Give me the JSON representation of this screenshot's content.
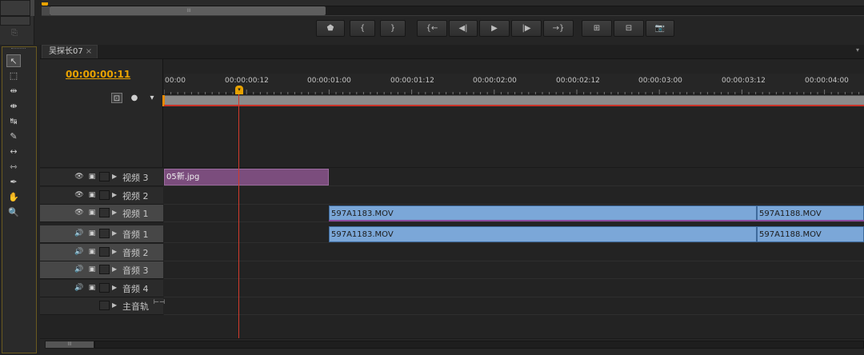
{
  "monitor": {
    "transport_buttons": [
      {
        "name": "add-marker-button",
        "glyph": "⬟"
      },
      {
        "name": "mark-in-button",
        "glyph": "{"
      },
      {
        "name": "mark-out-button",
        "glyph": "}"
      },
      {
        "name": "go-to-in-button",
        "glyph": "{←"
      },
      {
        "name": "step-back-button",
        "glyph": "◀|"
      },
      {
        "name": "play-stop-button",
        "glyph": "▶"
      },
      {
        "name": "step-forward-button",
        "glyph": "|▶"
      },
      {
        "name": "go-to-out-button",
        "glyph": "→}"
      },
      {
        "name": "lift-button",
        "glyph": "⊞"
      },
      {
        "name": "extract-button",
        "glyph": "⊟"
      },
      {
        "name": "export-frame-button",
        "glyph": "📷"
      }
    ]
  },
  "tools": [
    {
      "name": "selection-tool",
      "glyph": "↖",
      "selected": true
    },
    {
      "name": "track-select-tool",
      "glyph": "⬚"
    },
    {
      "name": "ripple-edit-tool",
      "glyph": "⇹"
    },
    {
      "name": "rolling-edit-tool",
      "glyph": "⇼"
    },
    {
      "name": "rate-stretch-tool",
      "glyph": "↹"
    },
    {
      "name": "razor-tool",
      "glyph": "✎"
    },
    {
      "name": "slip-tool",
      "glyph": "↔"
    },
    {
      "name": "slide-tool",
      "glyph": "⇿"
    },
    {
      "name": "pen-tool",
      "glyph": "✒"
    },
    {
      "name": "hand-tool",
      "glyph": "✋"
    },
    {
      "name": "zoom-tool",
      "glyph": "🔍"
    }
  ],
  "timeline": {
    "tab_label": "吴探长07",
    "tab_close": "×",
    "timecode": "00:00:00:11",
    "ruler_labels": [
      "00:00",
      "00:00:00:12",
      "00:00:01:00",
      "00:00:01:12",
      "00:00:02:00",
      "00:00:02:12",
      "00:00:03:00",
      "00:00:03:12",
      "00:00:04:00"
    ],
    "header_icons": {
      "snap": "⊡",
      "marker": "●",
      "set_marker": "▾"
    },
    "tracks": [
      {
        "kind": "video",
        "name": "视频 3",
        "visibility": "👁",
        "lock": "▣",
        "active": false
      },
      {
        "kind": "video",
        "name": "视频 2",
        "visibility": "👁",
        "lock": "▣",
        "active": false
      },
      {
        "kind": "video",
        "name": "视频 1",
        "visibility": "👁",
        "lock": "▣",
        "active": true
      },
      {
        "kind": "audio",
        "name": "音频 1",
        "visibility": "🔊",
        "lock": "▣",
        "active": true
      },
      {
        "kind": "audio",
        "name": "音频 2",
        "visibility": "🔊",
        "lock": "▣",
        "active": true
      },
      {
        "kind": "audio",
        "name": "音频 3",
        "visibility": "🔊",
        "lock": "▣",
        "active": true
      },
      {
        "kind": "audio",
        "name": "音频 4",
        "visibility": "🔊",
        "lock": "▣",
        "active": false
      },
      {
        "kind": "master",
        "name": "主音轨",
        "visibility": "",
        "lock": "",
        "active": false
      }
    ],
    "clips": {
      "v3_still": "05新.jpg",
      "v1_a": "597A1183.MOV",
      "v1_b": "597A1188.MOV",
      "a1_a": "597A1183.MOV",
      "a1_b": "597A1188.MOV"
    },
    "colors": {
      "timecode": "#e8a200",
      "still_clip": "#7b4d7d",
      "mov_clip": "#7ba7d8",
      "playhead": "#d23a2c",
      "panel_border": "#6a5a20"
    }
  }
}
